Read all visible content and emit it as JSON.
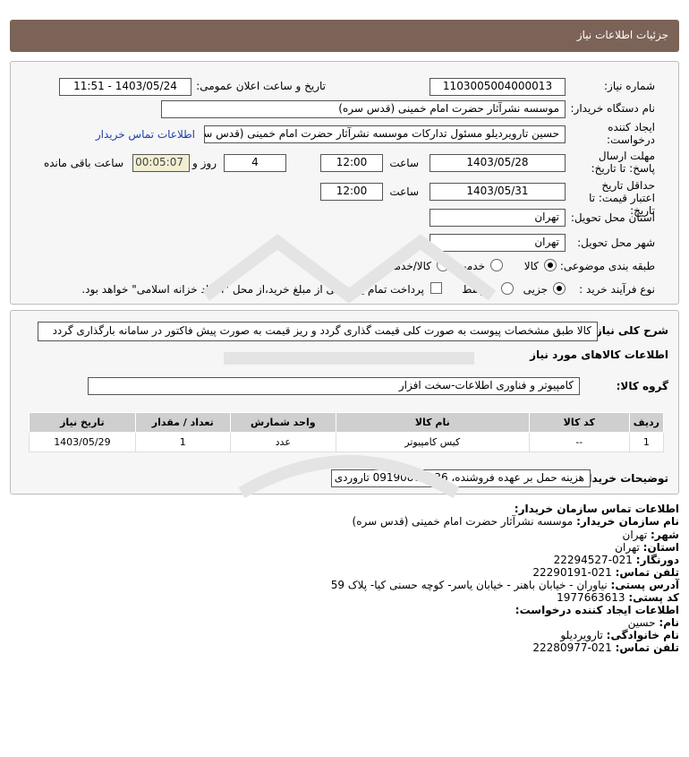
{
  "header": {
    "title": "جزئیات اطلاعات نیاز"
  },
  "details": {
    "need_number_label": "شماره نیاز:",
    "need_number": "1103005004000013",
    "announce_label": "تاریخ و ساعت اعلان عمومی:",
    "announce_value": "1403/05/24 - 11:51",
    "buyer_label": "نام دستگاه خریدار:",
    "buyer_value": "موسسه نشرآثار حضرت امام خمینی (قدس سره)",
    "creator_label": "ایجاد کننده درخواست:",
    "creator_value": "حسین تارویردیلو مسئول تدارکات موسسه نشرآثار حضرت امام خمینی (قدس سره)",
    "buyer_contact_link": "اطلاعات تماس خریدار",
    "reply_deadline_label": "مهلت ارسال پاسخ: تا تاریخ:",
    "reply_date": "1403/05/28",
    "time_label": "ساعت",
    "reply_time": "12:00",
    "days_value": "4",
    "days_label": "روز و",
    "remaining_time": "00:05:07",
    "remaining_label": "ساعت باقی مانده",
    "validity_label": "حداقل تاریخ اعتبار قیمت: تا تاریخ:",
    "validity_date": "1403/05/31",
    "validity_time": "12:00",
    "province_label": "استان محل تحویل:",
    "province_value": "تهران",
    "city_label": "شهر محل تحویل:",
    "city_value": "تهران",
    "category_label": "طبقه بندی موضوعی:",
    "category_options": [
      "کالا",
      "خدمت",
      "کالا/خدمت"
    ],
    "category_selected": "کالا",
    "process_label": "نوع فرآیند خرید :",
    "process_options": [
      "جزیی",
      "متوسط"
    ],
    "process_selected": "جزیی",
    "payment_note": "پرداخت تمام یا بخشی از مبلغ خرید،از محل \"اسناد خزانه اسلامی\" خواهد بود."
  },
  "description": {
    "label": "شرح کلی نیاز:",
    "value": "کالا طبق مشخصات پیوست به صورت کلی قیمت گذاری گردد و ریز قیمت به صورت پیش فاکتور در سامانه بارگذاری گردد",
    "goods_info_title": "اطلاعات کالاهای مورد نیاز",
    "group_label": "گروه کالا:",
    "group_value": "کامپیوتر و فناوری اطلاعات-سخت افزار"
  },
  "table": {
    "columns": [
      "ردیف",
      "کد کالا",
      "نام کالا",
      "واحد شمارش",
      "تعداد / مقدار",
      "تاریخ نیاز"
    ],
    "rows": [
      [
        "1",
        "--",
        "کیس کامپیوتر",
        "عدد",
        "1",
        "1403/05/29"
      ]
    ]
  },
  "buyer_notes": {
    "label": "توضیحات خریدار:",
    "value": "هزینه حمل بر عهده فروشنده، 09190866036 تاروردی"
  },
  "contact": {
    "title": "اطلاعات تماس سازمان خریدار:",
    "org_label": "نام سازمان خریدار:",
    "org_value": "موسسه نشرآثار حضرت امام خمینی (قدس سره)",
    "city_label": "شهر:",
    "city_value": "تهران",
    "province_label": "استان:",
    "province_value": "تهران",
    "fax_label": "دورنگار:",
    "fax_value": "021-22294527",
    "phone_label": "تلفن تماس:",
    "phone_value": "021-22290191",
    "address_label": "آدرس پستی:",
    "address_value": "نیاوران - خیابان باهنر - خیابان یاسر- کوچه حسنی کیا- پلاک 59",
    "postal_label": "کد پستی:",
    "postal_value": "1977663613",
    "creator_title": "اطلاعات ایجاد کننده درخواست:",
    "name_label": "نام:",
    "name_value": "حسین",
    "family_label": "نام خانوادگی:",
    "family_value": "تارویردیلو",
    "creator_phone_label": "تلفن تماس:",
    "creator_phone_value": "021-22280977"
  },
  "colors": {
    "header": "#7c6357",
    "panel": "#f6f6f6",
    "table_header": "#cfcfcf",
    "link": "#1f3ea8"
  }
}
